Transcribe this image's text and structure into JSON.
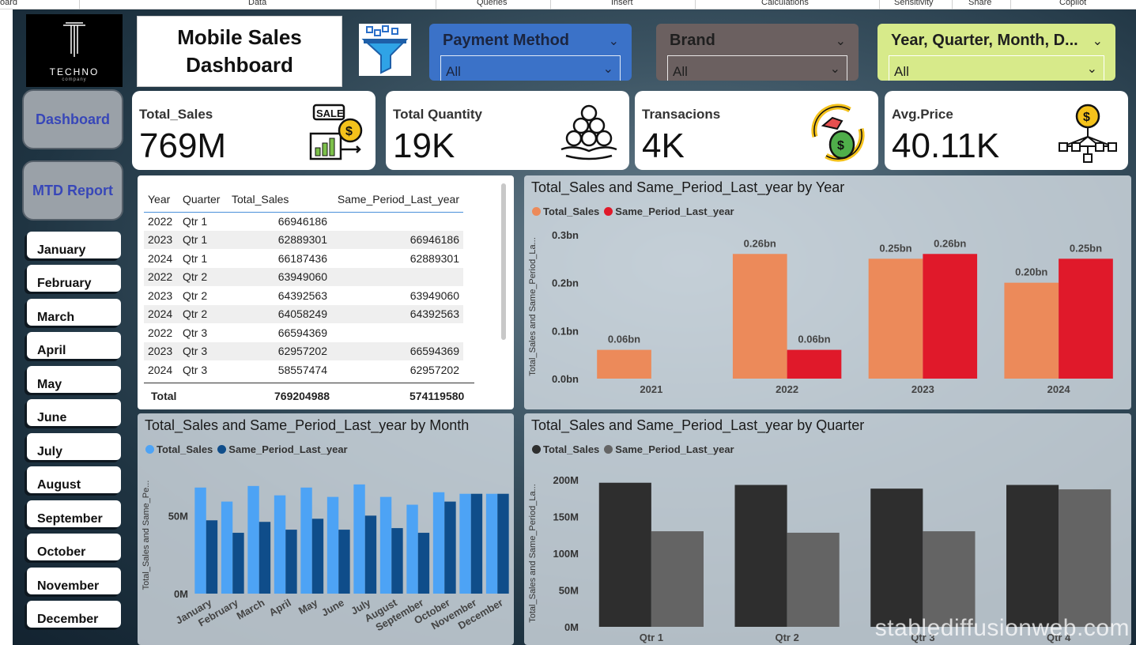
{
  "ribbon": [
    "oard",
    "Data",
    "Queries",
    "Insert",
    "Calculations",
    "Sensitivity",
    "Share",
    "Copilot"
  ],
  "logo": {
    "name": "TECHNO",
    "sub": "company"
  },
  "title": "Mobile Sales\nDashboard",
  "slicers": [
    {
      "label": "Payment Method",
      "value": "All",
      "bg": "#3b72c8",
      "fg": "#1b2540"
    },
    {
      "label": "Brand",
      "value": "All",
      "bg": "#6b6060",
      "fg": "#1f1f1f"
    },
    {
      "label": "Year, Quarter, Month, D...",
      "value": "All",
      "bg": "#d7ea8a",
      "fg": "#1f1f1f"
    }
  ],
  "nav": {
    "dashboard": "Dashboard",
    "mtd": "MTD Report"
  },
  "months": [
    "January",
    "February",
    "March",
    "April",
    "May",
    "June",
    "July",
    "August",
    "September",
    "October",
    "November",
    "December"
  ],
  "kpis": [
    {
      "title": "Total_Sales",
      "value": "769M",
      "icon": "sale-icon"
    },
    {
      "title": "Total Quantity",
      "value": "19K",
      "icon": "coins-hand-icon"
    },
    {
      "title": "Transacions",
      "value": "4K",
      "icon": "money-transfer-icon"
    },
    {
      "title": "Avg.Price",
      "value": "40.11K",
      "icon": "coin-network-icon"
    }
  ],
  "table": {
    "headers": [
      "Year",
      "Quarter",
      "Total_Sales",
      "Same_Period_Last_year"
    ],
    "rows": [
      [
        "2022",
        "Qtr 1",
        "66946186",
        ""
      ],
      [
        "2023",
        "Qtr 1",
        "62889301",
        "66946186"
      ],
      [
        "2024",
        "Qtr 1",
        "66187436",
        "62889301"
      ],
      [
        "2022",
        "Qtr 2",
        "63949060",
        ""
      ],
      [
        "2023",
        "Qtr 2",
        "64392563",
        "63949060"
      ],
      [
        "2024",
        "Qtr 2",
        "64058249",
        "64392563"
      ],
      [
        "2022",
        "Qtr 3",
        "66594369",
        ""
      ],
      [
        "2023",
        "Qtr 3",
        "62957202",
        "66594369"
      ],
      [
        "2024",
        "Qtr 3",
        "58557474",
        "62957202"
      ]
    ],
    "total_label": "Total",
    "total_sales": "769204988",
    "total_last": "574119580"
  },
  "chart_data": [
    {
      "type": "bar",
      "title": "Total_Sales and Same_Period_Last_year by Year",
      "ylabel": "Total_Sales and Same_Period_La...",
      "categories": [
        "2021",
        "2022",
        "2023",
        "2024"
      ],
      "series": [
        {
          "name": "Total_Sales",
          "color": "#ec8a5a",
          "values": [
            0.06,
            0.26,
            0.25,
            0.2
          ],
          "labels": [
            "0.06bn",
            "0.26bn",
            "0.25bn",
            "0.20bn"
          ]
        },
        {
          "name": "Same_Period_Last_year",
          "color": "#e0192a",
          "values": [
            null,
            0.06,
            0.26,
            0.25
          ],
          "labels": [
            "",
            "0.06bn",
            "0.26bn",
            "0.25bn"
          ]
        }
      ],
      "yticks": [
        "0.0bn",
        "0.1bn",
        "0.2bn",
        "0.3bn"
      ],
      "ylim": [
        0,
        0.3
      ]
    },
    {
      "type": "bar",
      "title": "Total_Sales and Same_Period_Last_year by Month",
      "ylabel": "Total_Sales and Same_Pe...",
      "categories": [
        "January",
        "February",
        "March",
        "April",
        "May",
        "June",
        "July",
        "August",
        "September",
        "October",
        "November",
        "December"
      ],
      "series": [
        {
          "name": "Total_Sales",
          "color": "#4da3f5",
          "values": [
            68,
            59,
            69,
            63,
            68,
            62,
            70,
            62,
            57,
            65,
            64,
            64
          ]
        },
        {
          "name": "Same_Period_Last_year",
          "color": "#0f4d8a",
          "values": [
            47,
            39,
            46,
            41,
            48,
            41,
            50,
            42,
            39,
            59,
            64,
            64
          ]
        }
      ],
      "yticks": [
        "0M",
        "50M"
      ],
      "ylim": [
        0,
        75
      ]
    },
    {
      "type": "bar",
      "title": "Total_Sales and Same_Period_Last_year by Quarter",
      "ylabel": "Total_Sales and Same_Period_La...",
      "categories": [
        "Qtr 1",
        "Qtr 2",
        "Qtr 3",
        "Qtr 4"
      ],
      "series": [
        {
          "name": "Total_Sales",
          "color": "#2e2e2e",
          "values": [
            196,
            193,
            188,
            193
          ]
        },
        {
          "name": "Same_Period_Last_year",
          "color": "#646464",
          "values": [
            130,
            128,
            130,
            187
          ]
        }
      ],
      "yticks": [
        "0M",
        "50M",
        "100M",
        "150M",
        "200M"
      ],
      "ylim": [
        0,
        200
      ]
    }
  ],
  "watermark": "stablediffusionweb.com"
}
